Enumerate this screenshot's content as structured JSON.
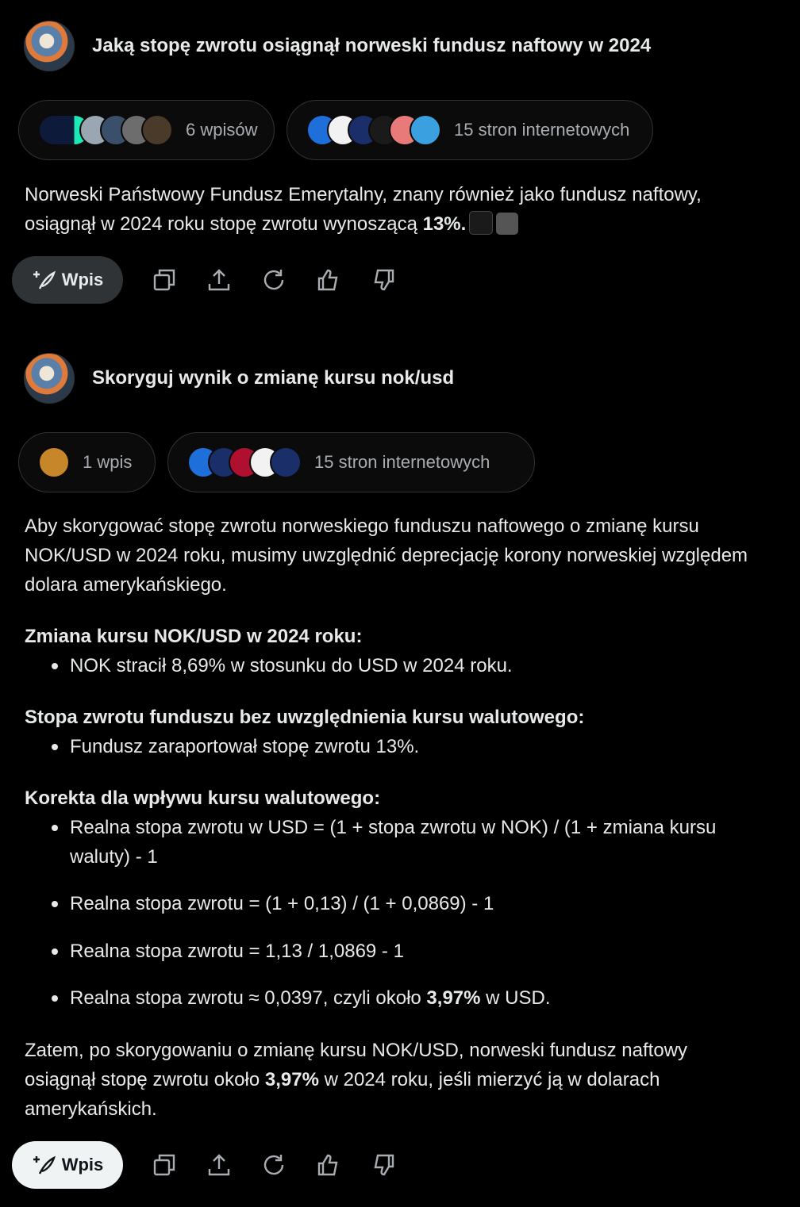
{
  "thread1": {
    "question": "Jaką stopę zwrotu osiągnął norweski fundusz naftowy w 2024",
    "posts_chip": "6 wpisów",
    "web_chip": "15 stron internetowych",
    "answer_pre": "Norweski Państwowy Fundusz Emerytalny, znany również jako fundusz naftowy, osiągnął w 2024 roku stopę zwrotu wynoszącą ",
    "answer_bold": "13%.",
    "wpis_label": "Wpis"
  },
  "thread2": {
    "question": "Skoryguj wynik o zmianę kursu nok/usd",
    "posts_chip": "1 wpis",
    "web_chip": "15 stron internetowych",
    "intro": "Aby skorygować stopę zwrotu norweskiego funduszu naftowego o zmianę kursu NOK/USD w 2024 roku, musimy uwzględnić deprecjację korony norweskiej względem dolara amerykańskiego.",
    "section1_title": "Zmiana kursu NOK/USD w 2024 roku:",
    "section1_bullet": "NOK stracił 8,69% w stosunku do USD w 2024 roku.",
    "section2_title": "Stopa zwrotu funduszu bez uwzględnienia kursu walutowego:",
    "section2_bullet": "Fundusz zaraportował stopę zwrotu 13%.",
    "section3_title": "Korekta dla wpływu kursu walutowego:",
    "section3_bullets": [
      "Realna stopa zwrotu w USD = (1 + stopa zwrotu w NOK) / (1 + zmiana kursu waluty) - 1",
      "Realna stopa zwrotu = (1 + 0,13) / (1 + 0,0869) - 1",
      "Realna stopa zwrotu = 1,13 / 1,0869 - 1",
      "Realna stopa zwrotu ≈ 0,0397, czyli około "
    ],
    "bullet4_bold": "3,97%",
    "bullet4_post": " w USD.",
    "conclusion_pre": "Zatem, po skorygowaniu o zmianę kursu NOK/USD, norweski fundusz naftowy osiągnął stopę zwrotu około ",
    "conclusion_bold": "3,97%",
    "conclusion_post": " w 2024 roku, jeśli mierzyć ją w dolarach amerykańskich.",
    "wpis_label": "Wpis"
  },
  "icons": {
    "avatar": "user-avatar",
    "copy": "copy-icon",
    "share": "share-icon",
    "regenerate": "regenerate-icon",
    "like": "thumbs-up-icon",
    "dislike": "thumbs-down-icon",
    "compose": "compose-icon"
  },
  "colors": {
    "background": "#000000",
    "text": "#e7e9ea",
    "muted": "#a9adb2",
    "chip_border": "#2f3336",
    "button_dark": "#2f3336",
    "button_light": "#eff3f4"
  }
}
